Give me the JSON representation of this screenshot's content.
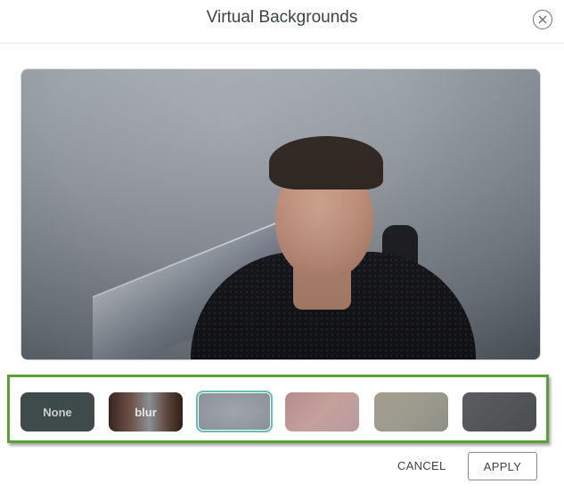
{
  "dialog": {
    "title": "Virtual Backgrounds",
    "close_icon": "close-circle-x-icon"
  },
  "preview": {
    "description": "Camera preview with gray virtual background applied"
  },
  "backgrounds": [
    {
      "id": "none",
      "label": "None",
      "selected": false
    },
    {
      "id": "blur",
      "label": "blur",
      "selected": false
    },
    {
      "id": "gray-texture",
      "label": "",
      "selected": true
    },
    {
      "id": "pink-gradient",
      "label": "",
      "selected": false
    },
    {
      "id": "beige-texture",
      "label": "",
      "selected": false
    },
    {
      "id": "dark-gray",
      "label": "",
      "selected": false
    }
  ],
  "colors": {
    "highlight_border": "#57a03a",
    "selected_border": "#5fc0b3",
    "text": "#3a4447"
  },
  "footer": {
    "cancel_label": "CANCEL",
    "apply_label": "APPLY"
  }
}
